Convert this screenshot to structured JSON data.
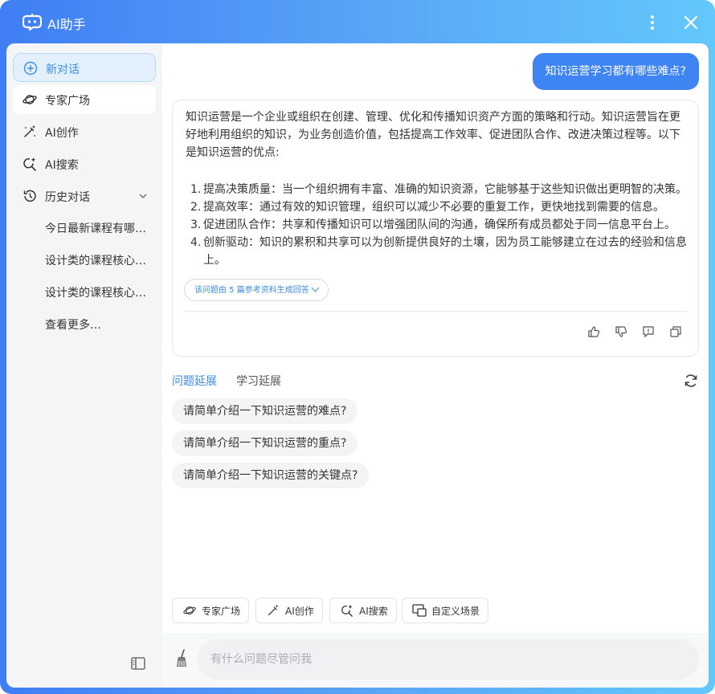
{
  "app": {
    "title": "AI助手"
  },
  "sidebar": {
    "new_chat": "新对话",
    "expert": "专家广场",
    "ai_create": "AI创作",
    "ai_search": "AI搜索",
    "history": "历史对话",
    "history_items": [
      "今日最新课程有哪…",
      "设计类的课程核心…",
      "设计类的课程核心…"
    ],
    "see_more": "查看更多…"
  },
  "chat": {
    "question": "知识运营学习都有哪些难点?",
    "answer_intro": "知识运营是一个企业或组织在创建、管理、优化和传播知识资产方面的策略和行动。知识运营旨在更好地利用组织的知识，为业务创造价值，包括提高工作效率、促进团队合作、改进决策过程等。以下是知识运营的优点:",
    "answer_points": [
      {
        "num": "1.",
        "text": "提高决策质量：当一个组织拥有丰富、准确的知识资源，它能够基于这些知识做出更明智的决策。"
      },
      {
        "num": "2.",
        "text": "提高效率：通过有效的知识管理，组织可以减少不必要的重复工作，更快地找到需要的信息。"
      },
      {
        "num": "3.",
        "text": "促进团队合作：共享和传播知识可以增强团队间的沟通，确保所有成员都处于同一信息平台上。"
      },
      {
        "num": "4.",
        "text": "创新驱动：知识的累积和共享可以为创新提供良好的土壤，因为员工能够建立在过去的经验和信息上。"
      }
    ],
    "refs": "该问题由 5 篇参考资料生成回答"
  },
  "extend": {
    "tab_questions": "问题延展",
    "tab_learning": "学习延展",
    "suggestions": [
      "请简单介绍一下知识运营的难点?",
      "请简单介绍一下知识运营的重点?",
      "请简单介绍一下知识运营的关键点?"
    ]
  },
  "toolbar": {
    "expert": "专家广场",
    "ai_create": "AI创作",
    "ai_search": "AI搜索",
    "custom": "自定义场景"
  },
  "input": {
    "placeholder": "有什么问题尽管问我"
  },
  "colors": {
    "accent": "#3c8de0",
    "bubble": "#3e84f2"
  },
  "icons": [
    "robot-logo-icon",
    "more-vertical-icon",
    "close-icon",
    "plus-circle-icon",
    "planet-icon",
    "magic-wand-icon",
    "sparkle-search-icon",
    "history-icon",
    "chevron-down-icon",
    "sidebar-toggle-icon",
    "thumbs-up-icon",
    "thumbs-down-icon",
    "feedback-icon",
    "copy-icon",
    "refresh-icon",
    "custom-scene-icon",
    "broom-icon"
  ]
}
